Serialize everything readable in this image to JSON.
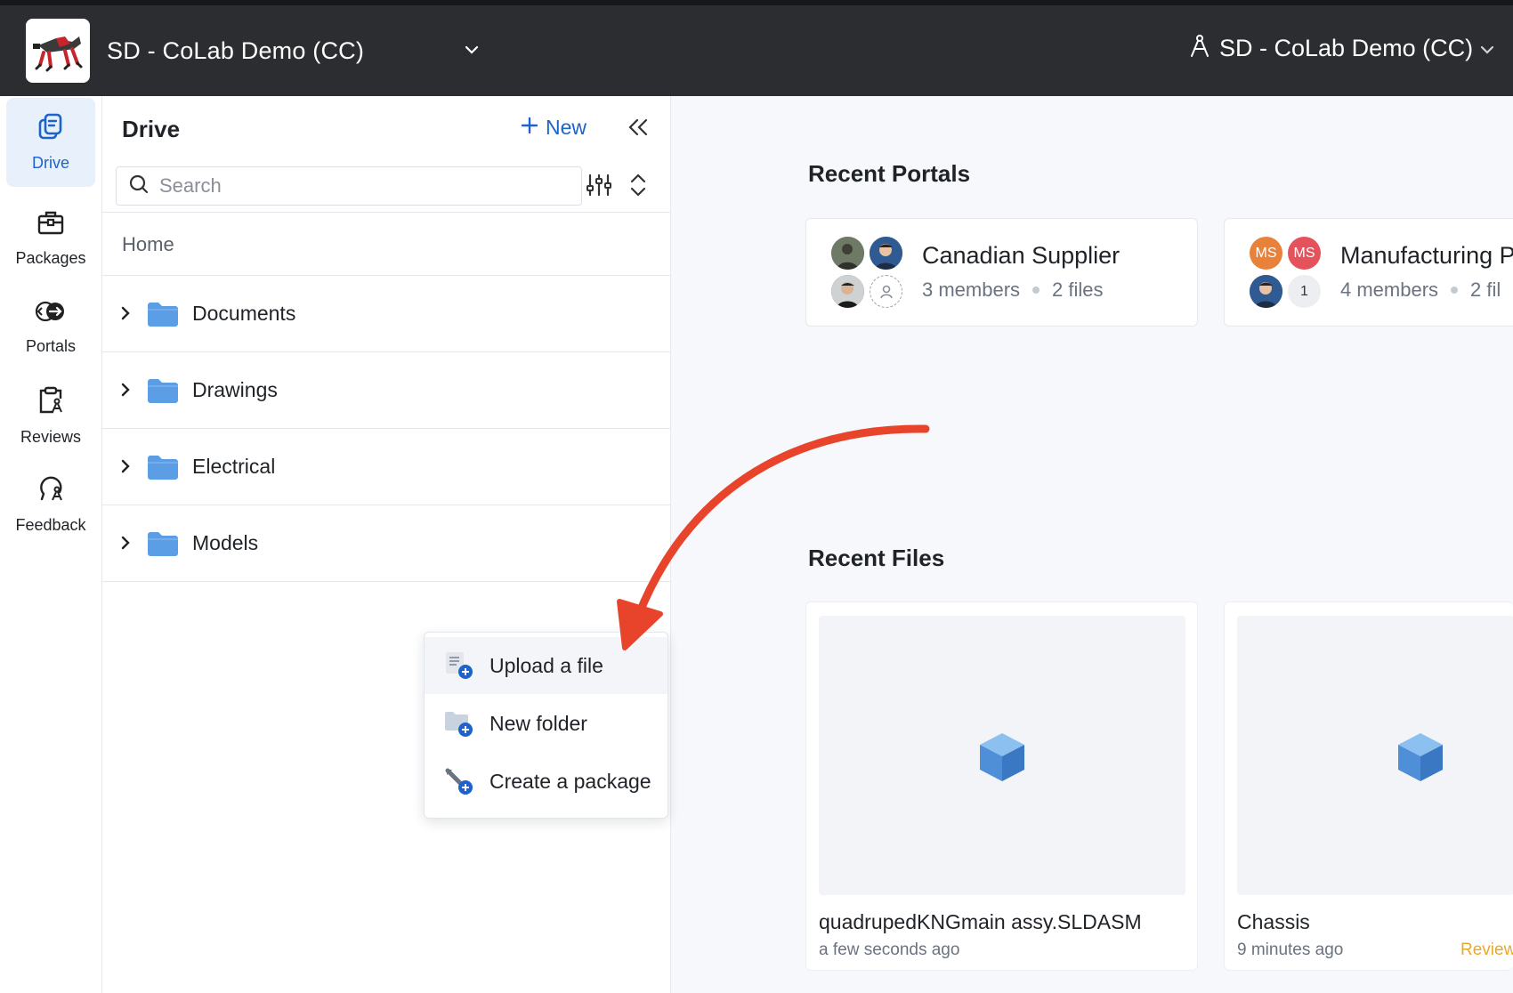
{
  "header": {
    "workspace_title": "SD - CoLab Demo (CC)",
    "user_workspace": "SD - CoLab Demo (CC)",
    "logo_icon": "robot-dog-logo"
  },
  "rail": {
    "items": [
      {
        "label": "Drive",
        "icon": "drive-icon",
        "active": true
      },
      {
        "label": "Packages",
        "icon": "briefcase-icon"
      },
      {
        "label": "Portals",
        "icon": "portal-icon"
      },
      {
        "label": "Reviews",
        "icon": "clipboard-icon"
      },
      {
        "label": "Feedback",
        "icon": "feedback-icon"
      }
    ]
  },
  "drive": {
    "title": "Drive",
    "new_label": "New",
    "search_placeholder": "Search",
    "breadcrumb": "Home",
    "folders": [
      {
        "name": "Documents"
      },
      {
        "name": "Drawings"
      },
      {
        "name": "Electrical"
      },
      {
        "name": "Models"
      }
    ]
  },
  "new_menu": {
    "items": [
      {
        "label": "Upload a file",
        "icon": "upload-file-icon"
      },
      {
        "label": "New folder",
        "icon": "new-folder-icon"
      },
      {
        "label": "Create a package",
        "icon": "create-package-icon"
      }
    ]
  },
  "recent_portals": {
    "title": "Recent Portals",
    "portals": [
      {
        "name": "Canadian Supplier",
        "members": "3 members",
        "files": "2 files"
      },
      {
        "name": "Manufacturing P",
        "members": "4 members",
        "files": "2 fil",
        "avatar_initials": [
          "MS",
          "MS"
        ],
        "extra_count": "1"
      }
    ]
  },
  "recent_files": {
    "title": "Recent Files",
    "files": [
      {
        "name": "quadrupedKNGmain assy.SLDASM",
        "time": "a few seconds ago",
        "status": ""
      },
      {
        "name": "Chassis",
        "time": "9 minutes ago",
        "status": "Review"
      }
    ]
  },
  "colors": {
    "accent": "#1d63c9",
    "topbar": "#2c2d31",
    "folder": "#5b9ee6",
    "annotation_arrow": "#e8442c",
    "status_review": "#e9a82a"
  }
}
